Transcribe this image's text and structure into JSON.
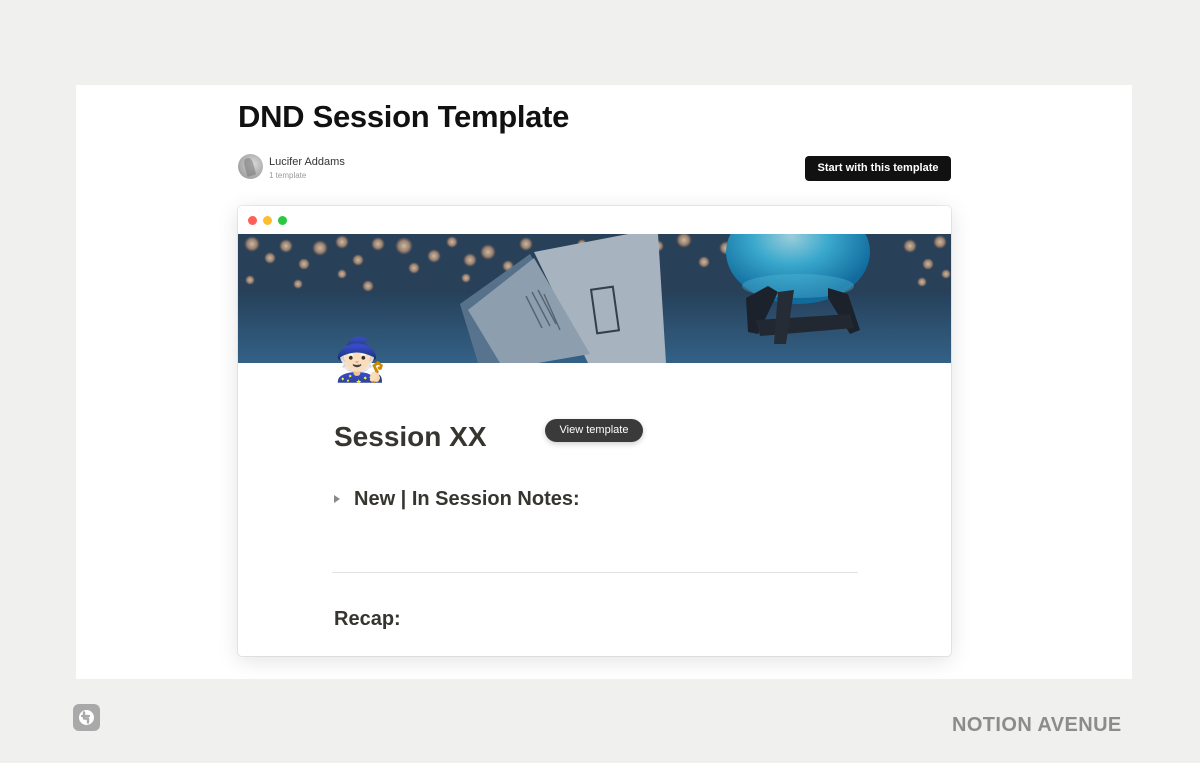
{
  "gallery": {
    "title": "DND Session Template",
    "author_name": "Lucifer Addams",
    "author_meta": "1 template",
    "start_button": "Start with this template"
  },
  "preview": {
    "page_icon": "🧙🏻",
    "view_button": "View template",
    "page_title": "Session XX",
    "toggle_heading": "New | In Session Notes:",
    "section_heading": "Recap:"
  },
  "footer": {
    "brand_name": "NOTION AVENUE"
  },
  "colors": {
    "page_background": "#f0f0ef",
    "button_dark": "#111111",
    "text_primary": "#37352f",
    "brand_gray": "#8c8c8c"
  },
  "icons": [
    "avatar",
    "window-close-dot",
    "window-minimize-dot",
    "window-zoom-dot",
    "wizard-emoji-icon",
    "toggle-arrow-icon",
    "notion-avenue-logo-icon"
  ]
}
